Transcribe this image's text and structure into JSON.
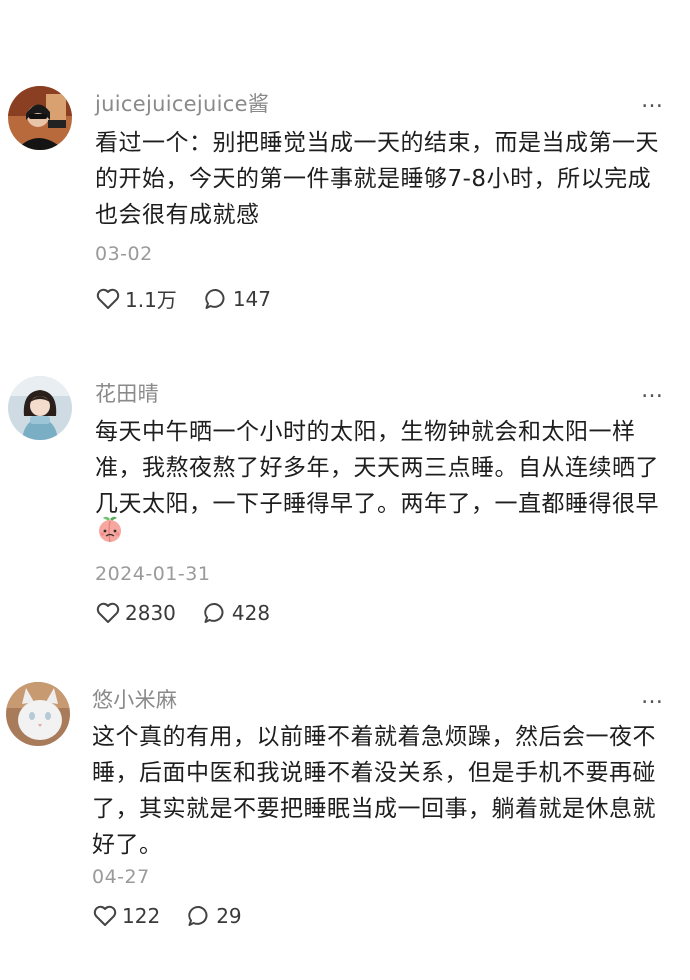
{
  "comments": [
    {
      "username": "juicejuicejuice酱",
      "text": "看过一个：别把睡觉当成一天的结束，而是当成第一天的开始，今天的第一件事就是睡够7-8小时，所以完成也会很有成就感",
      "date": "03-02",
      "likes": "1.1万",
      "replies": "147",
      "more_icon": "…"
    },
    {
      "username": "花田晴",
      "text": "每天中午晒一个小时的太阳，生物钟就会和太阳一样准，我熬夜熬了好多年，天天两三点睡。自从连续晒了几天太阳，一下子睡得早了。两年了，一直都睡得很早",
      "date": "2024-01-31",
      "likes": "2830",
      "replies": "428",
      "more_icon": "…"
    },
    {
      "username": "悠小米麻",
      "text": "这个真的有用，以前睡不着就着急烦躁，然后会一夜不睡，后面中医和我说睡不着没关系，但是手机不要再碰了，其实就是不要把睡眠当成一回事，躺着就是休息就好了。",
      "date": "04-27",
      "likes": "122",
      "replies": "29",
      "more_icon": "…"
    }
  ],
  "icons": {
    "like": "heart-icon",
    "reply": "comment-bubble-icon",
    "more": "more-dots-icon",
    "sticker": "peach-sticker-icon"
  }
}
